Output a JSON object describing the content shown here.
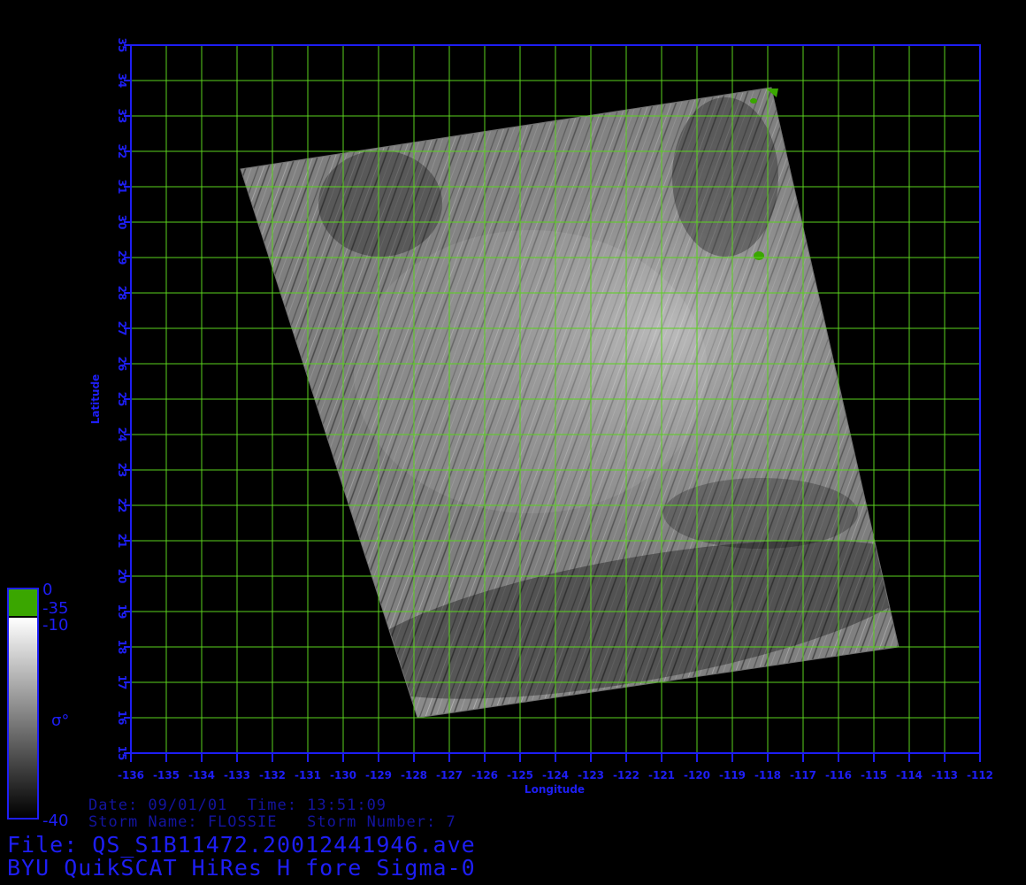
{
  "colors": {
    "axis": "#1e1ef5",
    "grid": "#5ad21e",
    "text": "#1e1ef5",
    "info_text": "#1414a0",
    "legend_green": "#3aa600",
    "background": "#000000"
  },
  "map": {
    "lon_range": [
      -136,
      -112
    ],
    "lat_range": [
      15,
      35
    ],
    "lon_ticks": [
      "-136",
      "-135",
      "-134",
      "-133",
      "-132",
      "-131",
      "-130",
      "-129",
      "-128",
      "-127",
      "-126",
      "-125",
      "-124",
      "-123",
      "-122",
      "-121",
      "-120",
      "-119",
      "-118",
      "-117",
      "-116",
      "-115",
      "-114",
      "-113",
      "-112"
    ],
    "lat_ticks": [
      "15",
      "16",
      "17",
      "18",
      "19",
      "20",
      "21",
      "22",
      "23",
      "24",
      "25",
      "26",
      "27",
      "28",
      "29",
      "30",
      "31",
      "32",
      "33",
      "34",
      "35"
    ],
    "xlabel": "Longitude",
    "ylabel": "Latitude",
    "swath_corners_lonlat": [
      [
        -132.9,
        31.5
      ],
      [
        -117.9,
        33.8
      ],
      [
        -114.3,
        18.0
      ],
      [
        -127.9,
        16.0
      ]
    ]
  },
  "legend": {
    "symbol": "σ°",
    "labels": [
      "0",
      "-35",
      "-10",
      "-40"
    ]
  },
  "info": {
    "line1": "Date: 09/01/01  Time: 13:51:09",
    "line2": "Storm Name: FLOSSIE   Storm Number: 7",
    "file_line": "File: QS_S1B11472.20012441946.ave",
    "product_line": "BYU QuikSCAT HiRes H fore Sigma-0"
  }
}
